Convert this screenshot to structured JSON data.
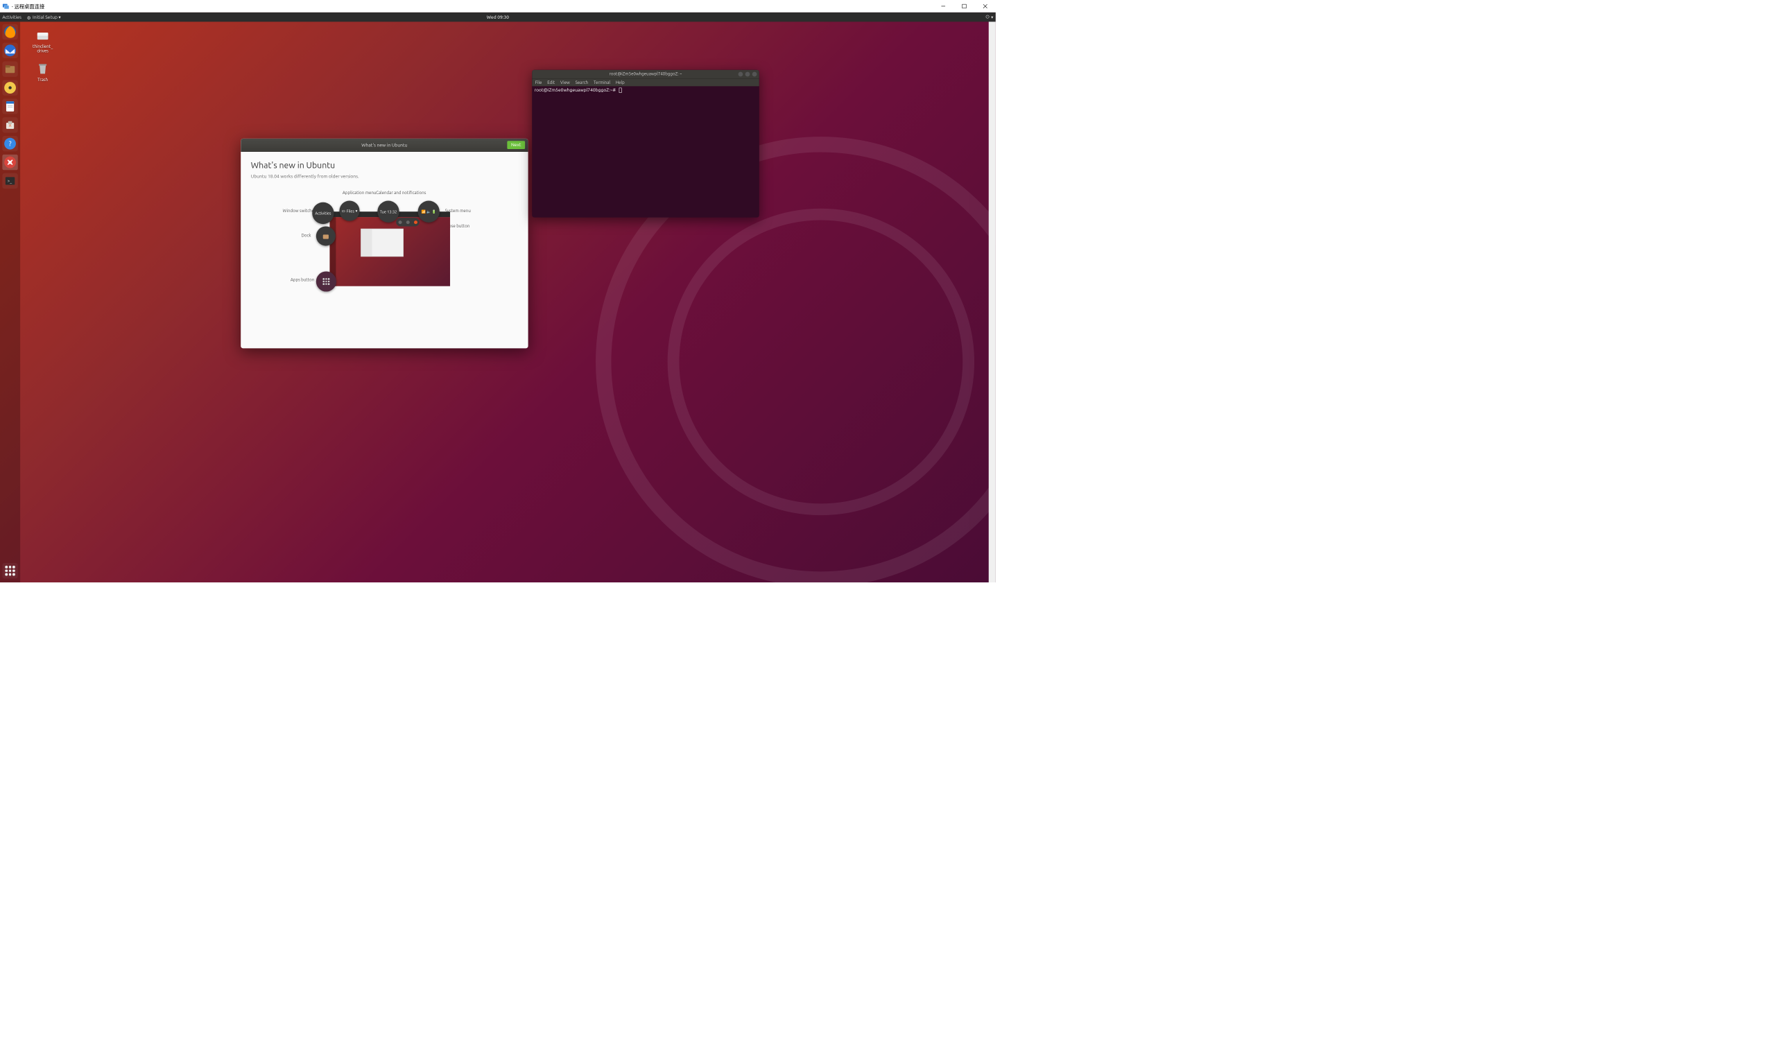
{
  "rdp": {
    "title": "  - 远程桌面连接"
  },
  "topbar": {
    "activities": "Activities",
    "setup": "Initial Setup",
    "clock": "Wed 09:30"
  },
  "desktop_icons": [
    {
      "name": "thinclient_drives",
      "label": "thinclient_\ndrives"
    },
    {
      "name": "trash",
      "label": "Trash"
    }
  ],
  "dock": {
    "items": [
      "firefox",
      "thunderbird",
      "files",
      "rhythmbox",
      "writer",
      "software",
      "help",
      "settings",
      "terminal"
    ]
  },
  "welcome": {
    "titlebar": "What's new in Ubuntu",
    "next": "Next",
    "heading": "What's new in Ubuntu",
    "sub": "Ubuntu 18.04 works differently from older versions.",
    "labels": {
      "window_switcher": "Window switcher",
      "application_menu": "Application menu",
      "calendar": "Calendar and notifications",
      "system_menu": "System menu",
      "dock": "Dock",
      "close_button": "Close button",
      "apps_button": "Apps button",
      "activities_chip": "Activities",
      "files_chip": "Files",
      "time_chip": "Tue 13:32"
    }
  },
  "terminal": {
    "title": "root@iZm5e0whgeuawpl740bggoZ: ~",
    "menu": [
      "File",
      "Edit",
      "View",
      "Search",
      "Terminal",
      "Help"
    ],
    "prompt": "root@iZm5e0whgeuawpl740bggoZ:~#"
  }
}
